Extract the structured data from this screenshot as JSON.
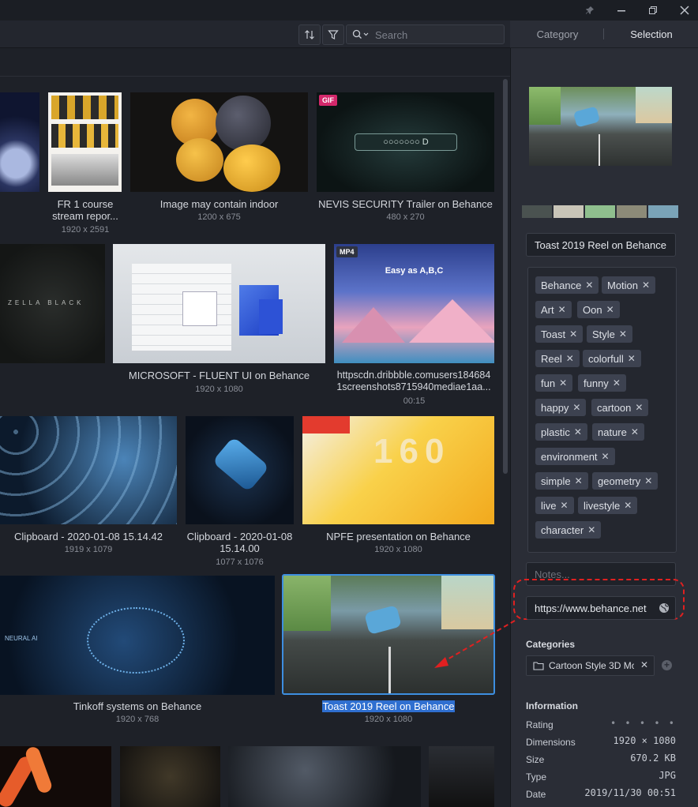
{
  "window": {
    "pin_icon": "pin-icon",
    "minimize_icon": "minimize-icon",
    "restore_icon": "restore-icon",
    "close_icon": "close-icon"
  },
  "toolbar": {
    "sort_icon": "sort-icon",
    "filter_icon": "filter-icon",
    "search_placeholder": "Search"
  },
  "grid": {
    "items": [
      {
        "caption": "FR 1 course stream repor...",
        "caption1": "FR 1 course",
        "caption2": "stream repor...",
        "dims": "1920 x 2591"
      },
      {
        "caption": "Image may contain indoor",
        "dims": "1200 x 675"
      },
      {
        "caption": "NEVIS SECURITY Trailer on Behance",
        "dims": "480 x 270",
        "badge": "GIF"
      },
      {
        "caption": "MICROSOFT - FLUENT UI on Behance",
        "dims": "1920 x 1080"
      },
      {
        "caption1": "httpscdn.dribbble.comusers184684",
        "caption2": "1screenshots8715940mediae1aa...",
        "dims": "00:15",
        "badge": "MP4"
      },
      {
        "caption": "Clipboard - 2020-01-08 15.14.42",
        "dims": "1919 x 1079"
      },
      {
        "caption1": "Clipboard - 2020-01-08",
        "caption2": "15.14.00",
        "dims": "1077 x 1076"
      },
      {
        "caption": "NPFE presentation on Behance",
        "dims": "1920 x 1080"
      },
      {
        "caption": "Tinkoff systems on Behance",
        "dims": "1920 x 768"
      },
      {
        "caption": "Toast 2019 Reel on Behance",
        "dims": "1920 x 1080"
      }
    ],
    "thumb_texts": {
      "zella": "ZELLA BLACK",
      "easy": "Easy as A,B,C",
      "neural": "NEURAL AI",
      "nevis": "○○○○○○○ D"
    }
  },
  "panel": {
    "tabs": [
      "Category",
      "Selection"
    ],
    "swatches": [
      "#4a5250",
      "#c9c5b8",
      "#8fbf8e",
      "#8c8a78",
      "#7aa3b8"
    ],
    "title_value": "Toast 2019 Reel on Behance",
    "tags": [
      "Behance",
      "Motion",
      "Art",
      "Oon",
      "Toast",
      "Style",
      "Reel",
      "colorfull",
      "fun",
      "funny",
      "happy",
      "cartoon",
      "plastic",
      "nature",
      "environment",
      "simple",
      "geometry",
      "live",
      "livestyle",
      "character"
    ],
    "notes_placeholder": "Notes...",
    "url_value": "https://www.behance.net",
    "categories_label": "Categories",
    "category_chip": "Cartoon Style 3D Mc",
    "information_label": "Information",
    "info": [
      {
        "label": "Rating",
        "value": "• • • • •"
      },
      {
        "label": "Dimensions",
        "value": "1920 × 1080"
      },
      {
        "label": "Size",
        "value": "670.2 KB"
      },
      {
        "label": "Type",
        "value": "JPG"
      },
      {
        "label": "Date",
        "value": "2019/11/30 00:51"
      }
    ]
  }
}
